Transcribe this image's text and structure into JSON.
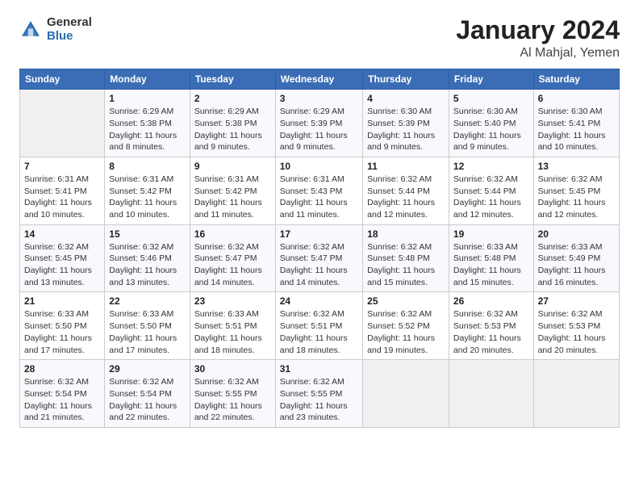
{
  "header": {
    "logo_general": "General",
    "logo_blue": "Blue",
    "month_title": "January 2024",
    "location": "Al Mahjal, Yemen"
  },
  "days_of_week": [
    "Sunday",
    "Monday",
    "Tuesday",
    "Wednesday",
    "Thursday",
    "Friday",
    "Saturday"
  ],
  "weeks": [
    [
      {
        "day": "",
        "info": ""
      },
      {
        "day": "1",
        "info": "Sunrise: 6:29 AM\nSunset: 5:38 PM\nDaylight: 11 hours and 8 minutes."
      },
      {
        "day": "2",
        "info": "Sunrise: 6:29 AM\nSunset: 5:38 PM\nDaylight: 11 hours and 9 minutes."
      },
      {
        "day": "3",
        "info": "Sunrise: 6:29 AM\nSunset: 5:39 PM\nDaylight: 11 hours and 9 minutes."
      },
      {
        "day": "4",
        "info": "Sunrise: 6:30 AM\nSunset: 5:39 PM\nDaylight: 11 hours and 9 minutes."
      },
      {
        "day": "5",
        "info": "Sunrise: 6:30 AM\nSunset: 5:40 PM\nDaylight: 11 hours and 9 minutes."
      },
      {
        "day": "6",
        "info": "Sunrise: 6:30 AM\nSunset: 5:41 PM\nDaylight: 11 hours and 10 minutes."
      }
    ],
    [
      {
        "day": "7",
        "info": "Sunrise: 6:31 AM\nSunset: 5:41 PM\nDaylight: 11 hours and 10 minutes."
      },
      {
        "day": "8",
        "info": "Sunrise: 6:31 AM\nSunset: 5:42 PM\nDaylight: 11 hours and 10 minutes."
      },
      {
        "day": "9",
        "info": "Sunrise: 6:31 AM\nSunset: 5:42 PM\nDaylight: 11 hours and 11 minutes."
      },
      {
        "day": "10",
        "info": "Sunrise: 6:31 AM\nSunset: 5:43 PM\nDaylight: 11 hours and 11 minutes."
      },
      {
        "day": "11",
        "info": "Sunrise: 6:32 AM\nSunset: 5:44 PM\nDaylight: 11 hours and 12 minutes."
      },
      {
        "day": "12",
        "info": "Sunrise: 6:32 AM\nSunset: 5:44 PM\nDaylight: 11 hours and 12 minutes."
      },
      {
        "day": "13",
        "info": "Sunrise: 6:32 AM\nSunset: 5:45 PM\nDaylight: 11 hours and 12 minutes."
      }
    ],
    [
      {
        "day": "14",
        "info": "Sunrise: 6:32 AM\nSunset: 5:45 PM\nDaylight: 11 hours and 13 minutes."
      },
      {
        "day": "15",
        "info": "Sunrise: 6:32 AM\nSunset: 5:46 PM\nDaylight: 11 hours and 13 minutes."
      },
      {
        "day": "16",
        "info": "Sunrise: 6:32 AM\nSunset: 5:47 PM\nDaylight: 11 hours and 14 minutes."
      },
      {
        "day": "17",
        "info": "Sunrise: 6:32 AM\nSunset: 5:47 PM\nDaylight: 11 hours and 14 minutes."
      },
      {
        "day": "18",
        "info": "Sunrise: 6:32 AM\nSunset: 5:48 PM\nDaylight: 11 hours and 15 minutes."
      },
      {
        "day": "19",
        "info": "Sunrise: 6:33 AM\nSunset: 5:48 PM\nDaylight: 11 hours and 15 minutes."
      },
      {
        "day": "20",
        "info": "Sunrise: 6:33 AM\nSunset: 5:49 PM\nDaylight: 11 hours and 16 minutes."
      }
    ],
    [
      {
        "day": "21",
        "info": "Sunrise: 6:33 AM\nSunset: 5:50 PM\nDaylight: 11 hours and 17 minutes."
      },
      {
        "day": "22",
        "info": "Sunrise: 6:33 AM\nSunset: 5:50 PM\nDaylight: 11 hours and 17 minutes."
      },
      {
        "day": "23",
        "info": "Sunrise: 6:33 AM\nSunset: 5:51 PM\nDaylight: 11 hours and 18 minutes."
      },
      {
        "day": "24",
        "info": "Sunrise: 6:32 AM\nSunset: 5:51 PM\nDaylight: 11 hours and 18 minutes."
      },
      {
        "day": "25",
        "info": "Sunrise: 6:32 AM\nSunset: 5:52 PM\nDaylight: 11 hours and 19 minutes."
      },
      {
        "day": "26",
        "info": "Sunrise: 6:32 AM\nSunset: 5:53 PM\nDaylight: 11 hours and 20 minutes."
      },
      {
        "day": "27",
        "info": "Sunrise: 6:32 AM\nSunset: 5:53 PM\nDaylight: 11 hours and 20 minutes."
      }
    ],
    [
      {
        "day": "28",
        "info": "Sunrise: 6:32 AM\nSunset: 5:54 PM\nDaylight: 11 hours and 21 minutes."
      },
      {
        "day": "29",
        "info": "Sunrise: 6:32 AM\nSunset: 5:54 PM\nDaylight: 11 hours and 22 minutes."
      },
      {
        "day": "30",
        "info": "Sunrise: 6:32 AM\nSunset: 5:55 PM\nDaylight: 11 hours and 22 minutes."
      },
      {
        "day": "31",
        "info": "Sunrise: 6:32 AM\nSunset: 5:55 PM\nDaylight: 11 hours and 23 minutes."
      },
      {
        "day": "",
        "info": ""
      },
      {
        "day": "",
        "info": ""
      },
      {
        "day": "",
        "info": ""
      }
    ]
  ]
}
